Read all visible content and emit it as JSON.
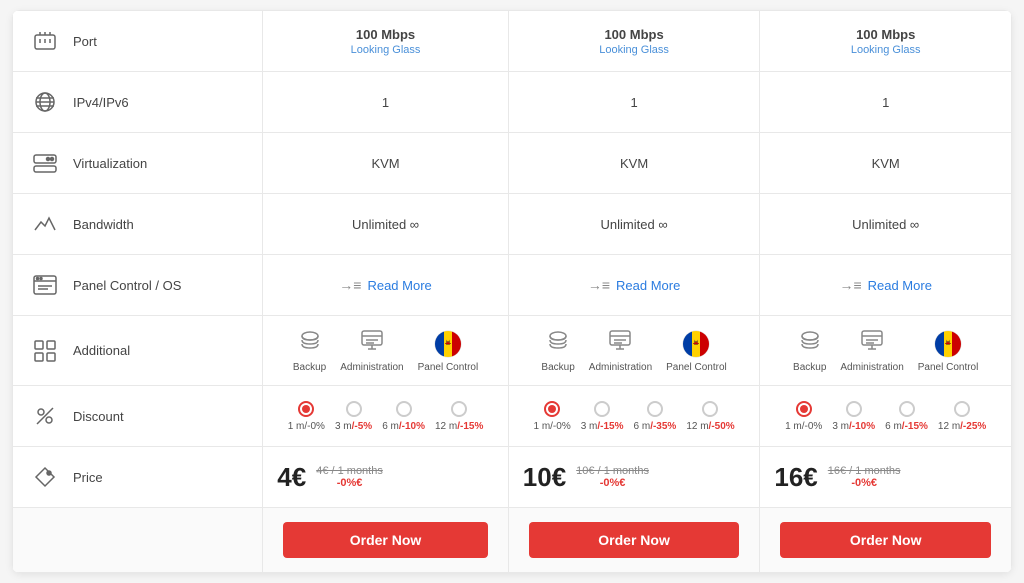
{
  "columns": [
    {
      "id": "col1",
      "price_big": "4€",
      "price_original": "4€",
      "price_months": "/ 1 months",
      "price_discounted": "-0%€",
      "order_label": "Order Now",
      "port_speed": "100 Mbps",
      "looking_glass": "Looking Glass",
      "ipv": "1",
      "virtualization": "KVM",
      "bandwidth": "Unlimited ∞",
      "read_more": "Read More",
      "discounts": [
        {
          "label": "1 m/-0%",
          "highlight": false,
          "selected": true
        },
        {
          "label": "3 m/-5%",
          "highlight": false,
          "selected": false
        },
        {
          "label": "6 m/-10%",
          "highlight": true,
          "selected": false
        },
        {
          "label": "12 m/-15%",
          "highlight": true,
          "selected": false
        }
      ]
    },
    {
      "id": "col2",
      "price_big": "10€",
      "price_original": "10€",
      "price_months": "/ 1 months",
      "price_discounted": "-0%€",
      "order_label": "Order Now",
      "port_speed": "100 Mbps",
      "looking_glass": "Looking Glass",
      "ipv": "1",
      "virtualization": "KVM",
      "bandwidth": "Unlimited ∞",
      "read_more": "Read More",
      "discounts": [
        {
          "label": "1 m/-0%",
          "highlight": false,
          "selected": true
        },
        {
          "label": "3 m/-15%",
          "highlight": true,
          "selected": false
        },
        {
          "label": "6 m/-35%",
          "highlight": true,
          "selected": false
        },
        {
          "label": "12 m/-50%",
          "highlight": true,
          "selected": false
        }
      ]
    },
    {
      "id": "col3",
      "price_big": "16€",
      "price_original": "16€",
      "price_months": "/ 1 months",
      "price_discounted": "-0%€",
      "order_label": "Order Now",
      "port_speed": "100 Mbps",
      "looking_glass": "Looking Glass",
      "ipv": "1",
      "virtualization": "KVM",
      "bandwidth": "Unlimited ∞",
      "read_more": "Read More",
      "discounts": [
        {
          "label": "1 m/-0%",
          "highlight": false,
          "selected": true
        },
        {
          "label": "3 m/-10%",
          "highlight": true,
          "selected": false
        },
        {
          "label": "6 m/-15%",
          "highlight": true,
          "selected": false
        },
        {
          "label": "12 m/-25%",
          "highlight": true,
          "selected": false
        }
      ]
    }
  ],
  "features": [
    {
      "id": "port",
      "label": "Port"
    },
    {
      "id": "ipv",
      "label": "IPv4/IPv6"
    },
    {
      "id": "virtualization",
      "label": "Virtualization"
    },
    {
      "id": "bandwidth",
      "label": "Bandwidth"
    },
    {
      "id": "panel",
      "label": "Panel Control / OS"
    },
    {
      "id": "additional",
      "label": "Additional"
    },
    {
      "id": "discount",
      "label": "Discount"
    },
    {
      "id": "price",
      "label": "Price"
    }
  ],
  "addons": [
    {
      "label": "Backup"
    },
    {
      "label": "Administration"
    },
    {
      "label": "Panel Control"
    }
  ],
  "accent_color": "#e53935",
  "link_color": "#2b7ce0"
}
